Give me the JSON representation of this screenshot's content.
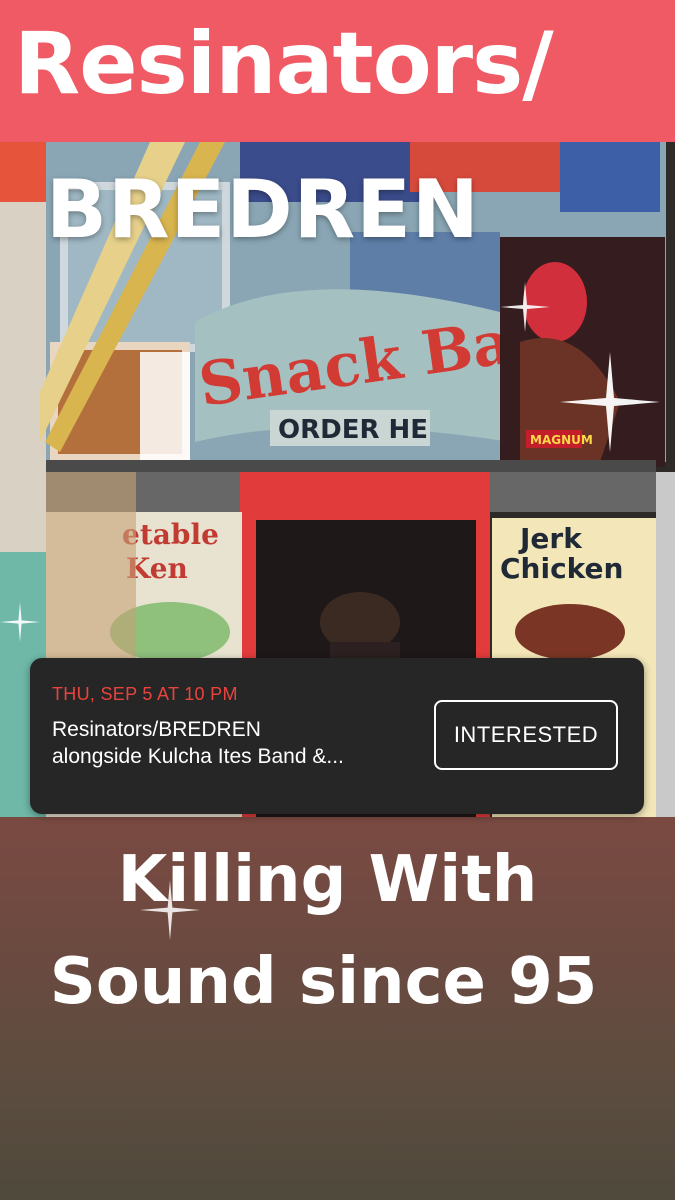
{
  "header": {
    "title_line1": "Resinators/",
    "title_line2": "BREDREN"
  },
  "photo": {
    "sign_snack_bar": "Snack Ba",
    "sign_order_here": "ORDER HE",
    "sign_vegetable": "etable",
    "sign_chicken_left": "Ken",
    "sign_jerk": "Jerk",
    "sign_chicken": "Chicken",
    "poster_brand": "MAGNUM"
  },
  "event": {
    "date": "THU, SEP 5 AT 10 PM",
    "title_line1": "Resinators/BREDREN",
    "title_line2": "alongside Kulcha Ites Band &...",
    "interested_label": "INTERESTED"
  },
  "tagline": {
    "line1": "Killing With",
    "line2": "Sound since 95"
  },
  "colors": {
    "top_band": "#ef5a64",
    "event_date": "#e8443d",
    "card_bg": "#262626"
  }
}
